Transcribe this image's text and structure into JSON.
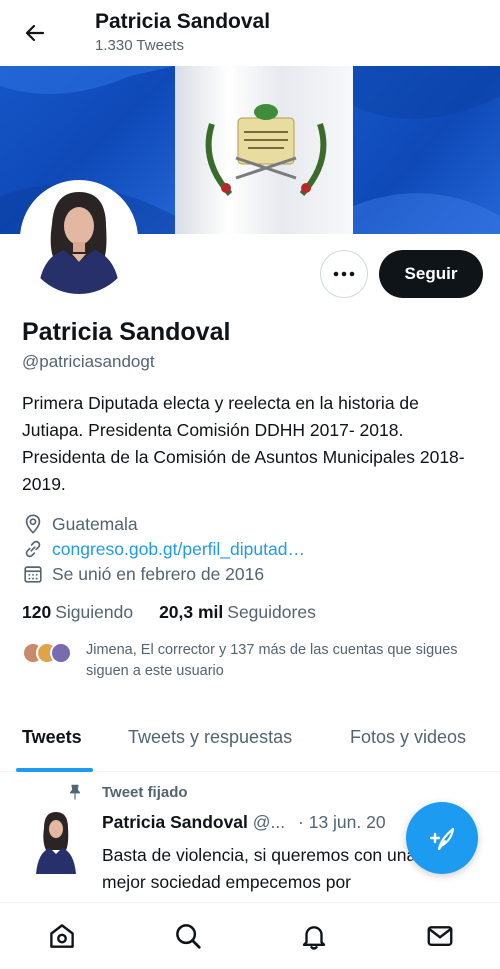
{
  "header": {
    "name": "Patricia Sandoval",
    "tweet_count": "1.330 Tweets"
  },
  "actions": {
    "more_label": "···",
    "follow_label": "Seguir"
  },
  "profile": {
    "name": "Patricia Sandoval",
    "handle": "@patriciasandogt",
    "bio": "Primera Diputada electa y reelecta en la historia de Jutiapa. Presidenta Comisión DDHH 2017- 2018. Presidenta de la Comisión de Asuntos Municipales 2018-2019.",
    "location": "Guatemala",
    "website": "congreso.gob.gt/perfil_diputad…",
    "joined": "Se unió en febrero de 2016"
  },
  "stats": {
    "following_count": "120",
    "following_label": "Siguiendo",
    "followers_count": "20,3 mil",
    "followers_label": "Seguidores"
  },
  "known_followers": "Jimena, El corrector y 137 más de las cuentas que sigues siguen a este usuario",
  "tabs": [
    {
      "label": "Tweets",
      "active": true
    },
    {
      "label": "Tweets y respuestas",
      "active": false
    },
    {
      "label": "Fotos y videos",
      "active": false
    }
  ],
  "pinned_tweet": {
    "pinned_label": "Tweet fijado",
    "author": "Patricia Sandoval",
    "handle": "@...",
    "date": "· 13 jun. 20",
    "text": "Basta de violencia, si queremos con una mejor sociedad empecemos por"
  },
  "colors": {
    "accent": "#1d9bf0",
    "text_primary": "#0f1419",
    "text_secondary": "#536471",
    "follow_bg": "#0f1419"
  },
  "icons": {
    "back": "arrow-left-icon",
    "more": "more-dots-icon",
    "location": "map-pin-icon",
    "link": "link-icon",
    "calendar": "calendar-icon",
    "pin": "pin-icon",
    "compose": "compose-feather-icon",
    "home": "home-icon",
    "search": "search-icon",
    "notifications": "bell-icon",
    "messages": "mail-icon"
  }
}
